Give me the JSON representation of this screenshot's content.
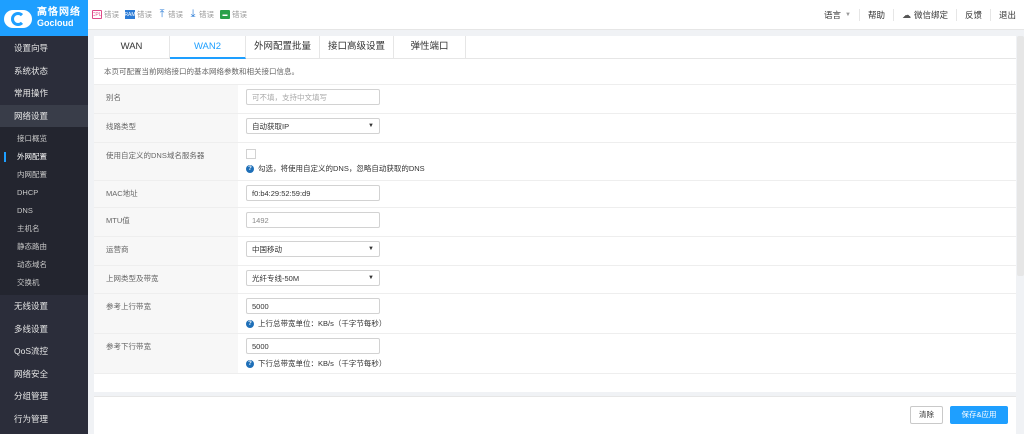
{
  "brand": {
    "name_cn": "高恪网络",
    "name_en": "Gocloud"
  },
  "toolbar_icons": [
    {
      "icon": "cpu-icon",
      "label": "错误"
    },
    {
      "icon": "ram-icon",
      "label": "错误"
    },
    {
      "icon": "upload-arrow-icon",
      "label": "错误"
    },
    {
      "icon": "download-arrow-icon",
      "label": "错误"
    },
    {
      "icon": "monitor-icon",
      "label": "错误"
    }
  ],
  "header_right": {
    "language": "语言",
    "help": "帮助",
    "wechat": "微信绑定",
    "feedback": "反馈",
    "logout": "退出"
  },
  "sidebar": {
    "items": [
      {
        "label": "设置向导"
      },
      {
        "label": "系统状态"
      },
      {
        "label": "常用操作"
      },
      {
        "label": "网络设置",
        "expanded": true
      },
      {
        "label": "无线设置"
      },
      {
        "label": "多线设置"
      },
      {
        "label": "QoS流控"
      },
      {
        "label": "网络安全"
      },
      {
        "label": "分组管理"
      },
      {
        "label": "行为管理"
      }
    ],
    "subitems": [
      {
        "label": "接口概览"
      },
      {
        "label": "外网配置",
        "active": true
      },
      {
        "label": "内网配置"
      },
      {
        "label": "DHCP"
      },
      {
        "label": "DNS"
      },
      {
        "label": "主机名"
      },
      {
        "label": "静态路由"
      },
      {
        "label": "动态域名"
      },
      {
        "label": "交换机"
      }
    ]
  },
  "tabs": [
    {
      "label": "WAN"
    },
    {
      "label": "WAN2",
      "active": true
    },
    {
      "label": "外网配置批量"
    },
    {
      "label": "接口高级设置"
    },
    {
      "label": "弹性端口"
    }
  ],
  "info_text": "本页可配置当前网络接口的基本网络参数和相关接口信息。",
  "form": {
    "alias": {
      "label": "别名",
      "placeholder": "可不填，支持中文填写"
    },
    "line_type": {
      "label": "线路类型",
      "value": "自动获取IP"
    },
    "custom_dns": {
      "label": "使用自定义的DNS域名服务器",
      "hint": "勾选，将使用自定义的DNS，忽略自动获取的DNS"
    },
    "mac": {
      "label": "MAC地址",
      "value": "f0:b4:29:52:59:d9"
    },
    "mtu": {
      "label": "MTU值",
      "value": "1492"
    },
    "isp": {
      "label": "运营商",
      "value": "中国移动"
    },
    "bandwidth_type": {
      "label": "上网类型及带宽",
      "value": "光纤专线-50M"
    },
    "upload": {
      "label": "参考上行带宽",
      "value": "5000",
      "hint": "上行总带宽单位：KB/s（千字节每秒）"
    },
    "download": {
      "label": "参考下行带宽",
      "value": "5000",
      "hint": "下行总带宽单位：KB/s（千字节每秒）"
    }
  },
  "buttons": {
    "clear": "清除",
    "save": "保存&应用"
  },
  "colors": {
    "accent": "#1e9fff",
    "sidebar_bg": "#2b2d3a"
  }
}
